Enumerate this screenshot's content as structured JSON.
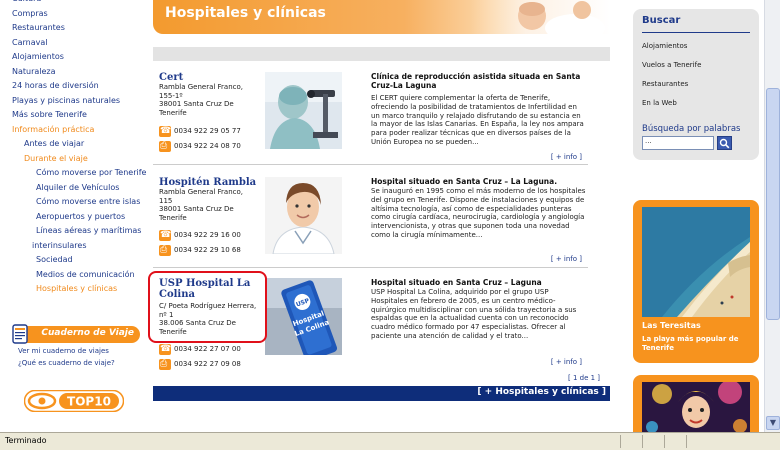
{
  "nav": {
    "items": [
      {
        "label": "Cultura",
        "level": 0,
        "color": "blue"
      },
      {
        "label": "Compras",
        "level": 0,
        "color": "blue"
      },
      {
        "label": "Restaurantes",
        "level": 0,
        "color": "blue"
      },
      {
        "label": "Carnaval",
        "level": 0,
        "color": "blue"
      },
      {
        "label": "Alojamientos",
        "level": 0,
        "color": "blue"
      },
      {
        "label": "Naturaleza",
        "level": 0,
        "color": "blue"
      },
      {
        "label": "24 horas de diversión",
        "level": 0,
        "color": "blue"
      },
      {
        "label": "Playas y piscinas naturales",
        "level": 0,
        "color": "blue"
      },
      {
        "label": "Más sobre Tenerife",
        "level": 0,
        "color": "blue"
      },
      {
        "label": "Información práctica",
        "level": 0,
        "color": "orange"
      },
      {
        "label": "Antes de viajar",
        "level": 1,
        "color": "blue"
      },
      {
        "label": "Durante el viaje",
        "level": 1,
        "color": "orange"
      },
      {
        "label": "Cómo moverse por Tenerife",
        "level": 2,
        "color": "blue"
      },
      {
        "label": "Alquiler de Vehículos",
        "level": 2,
        "color": "blue"
      },
      {
        "label": "Cómo moverse entre islas",
        "level": 2,
        "color": "blue"
      },
      {
        "label": "Aeropuertos y puertos",
        "level": 2,
        "color": "blue"
      },
      {
        "label": "Líneas aéreas y marítimas",
        "level": 2,
        "color": "blue"
      },
      {
        "label": "interinsulares",
        "level": 3,
        "color": "blue"
      },
      {
        "label": "Sociedad",
        "level": 2,
        "color": "blue"
      },
      {
        "label": "Medios de comunicación",
        "level": 2,
        "color": "blue"
      },
      {
        "label": "Hospitales y clínicas",
        "level": 2,
        "color": "orange"
      }
    ]
  },
  "cuaderno": {
    "title": "Cuaderno de Viaje",
    "link1": "Ver mi cuaderno de viajes",
    "link2": "¿Qué es cuaderno de viaje?"
  },
  "top10": {
    "label": "TOP10"
  },
  "banner": {
    "title": "Hospitales y clínicas"
  },
  "listings": [
    {
      "name": "Cert",
      "address": [
        "Rambla General Franco,",
        "155-1º",
        "38001 Santa Cruz De",
        "Tenerife"
      ],
      "phone": "0034 922 29 05 77",
      "fax": "0034 922 24 08 70",
      "headline": "Clínica de reproducción asistida situada en Santa Cruz-La Laguna",
      "description": "El CERT quiere complementar la oferta de Tenerife, ofreciendo la posibilidad de tratamientos de Infertilidad en un marco tranquilo y relajado disfrutando de su estancia en la mayor de las Islas Canarias. En España, la ley nos ampara para poder realizar técnicas que en diversos países de la Unión Europea no se pueden...",
      "more": "[ + info ]"
    },
    {
      "name": "Hospitén Rambla",
      "address": [
        "Rambla General Franco,",
        "115",
        "38001 Santa Cruz De",
        "Tenerife"
      ],
      "phone": "0034 922 29 16 00",
      "fax": "0034 922 29 10 68",
      "headline": "Hospital situado en Santa Cruz – La Laguna.",
      "description": "Se inauguró en 1995 como el más moderno de los hospitales del grupo en Tenerife. Dispone de instalaciones y equipos de altísima tecnología, así como de especialidades punteras como cirugía cardíaca, neurocirugía, cardiología y angiología intervencionista, y otras que suponen toda una novedad como la cirugía mínimamente...",
      "more": "[ + info ]"
    },
    {
      "name": "USP Hospital La Colina",
      "address": [
        "C/ Poeta Rodríguez Herrera,",
        "nº 1",
        "38.006 Santa Cruz De",
        "Tenerife"
      ],
      "phone": "0034 922 27 07 00",
      "fax": "0034 922 27 09 08",
      "headline": "Hospital situado en Santa Cruz – Laguna",
      "description": "USP Hospital La Colina, adquirido por el grupo USP Hospitales en febrero de 2005, es un centro médico-quirúrgico multidisciplinar con una sólida trayectoria a sus espaldas que en la actualidad cuenta con un reconocido cuadro médico formado por 47 especialistas. Ofrecer al paciente una atención de calidad y el trato...",
      "more": "[ + info ]"
    }
  ],
  "photo_sign": {
    "line1": "USP",
    "line2": "Hospital",
    "line3": "La Colina"
  },
  "pagination": "[ 1 de 1 ]",
  "footerbar": "[ + Hospitales y clínicas ]",
  "buscar": {
    "title": "Buscar",
    "links": [
      "Alojamientos",
      "Vuelos a Tenerife",
      "Restaurantes",
      "En la Web"
    ],
    "keyword_label": "Búsqueda por palabras",
    "input_value": "...",
    "go_icon": "search-icon"
  },
  "promo1": {
    "title": "Las Teresitas",
    "subtitle": "La playa más popular de Tenerife"
  },
  "status": {
    "text": "Terminado"
  },
  "colors": {
    "orange": "#f7931e",
    "navy": "#0e2d7a",
    "link": "#1f3a8a",
    "highlight": "#e0101a"
  }
}
